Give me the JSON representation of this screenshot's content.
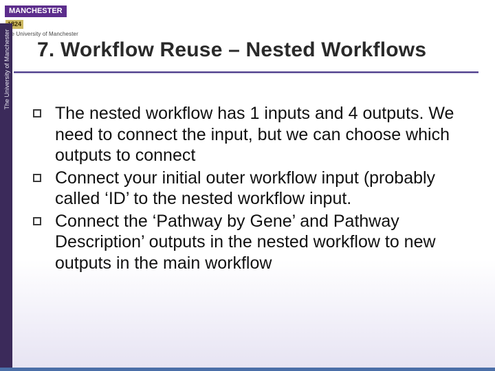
{
  "logo": {
    "brand": "MANCHESTER",
    "year": "1824",
    "subtitle": "The University of Manchester"
  },
  "sidebar": {
    "label": "The University of Manchester"
  },
  "slide": {
    "title": "7. Workflow Reuse – Nested Workflows",
    "bullets": [
      "The nested workflow has 1 inputs and 4 outputs. We need to connect the input, but we can choose which outputs to connect",
      "Connect your initial outer workflow input (probably called ‘ID’ to the nested workflow input.",
      "Connect the ‘Pathway by Gene’ and Pathway Description’ outputs in the nested workflow to new outputs in the main workflow"
    ]
  }
}
